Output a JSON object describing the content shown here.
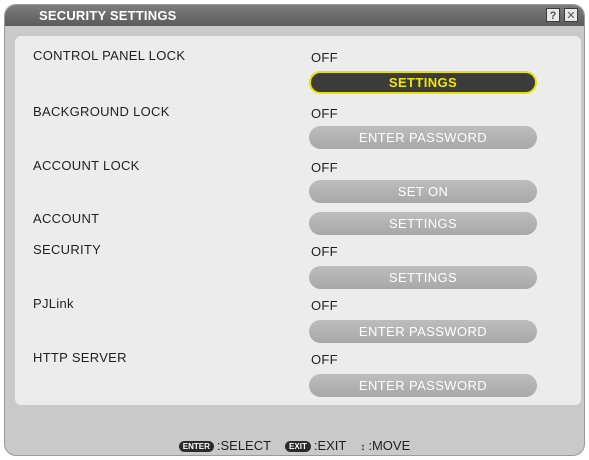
{
  "window": {
    "title": "SECURITY SETTINGS",
    "help_icon": "?",
    "close_icon": "✕"
  },
  "rows": {
    "control_panel_lock": {
      "label": "CONTROL PANEL LOCK",
      "value": "OFF",
      "button": "SETTINGS"
    },
    "background_lock": {
      "label": "BACKGROUND LOCK",
      "value": "OFF",
      "button": "ENTER PASSWORD"
    },
    "account_lock": {
      "label": "ACCOUNT LOCK",
      "value": "OFF",
      "button": "SET ON"
    },
    "account": {
      "label": "ACCOUNT",
      "button": "SETTINGS"
    },
    "security": {
      "label": "SECURITY",
      "value": "OFF",
      "button": "SETTINGS"
    },
    "pjlink": {
      "label": "PJLink",
      "value": "OFF",
      "button": "ENTER PASSWORD"
    },
    "http_server": {
      "label": "HTTP SERVER",
      "value": "OFF",
      "button": "ENTER PASSWORD"
    }
  },
  "footer": {
    "enter_key": "ENTER",
    "select_label": ":SELECT",
    "exit_key": "EXIT",
    "exit_label": ":EXIT",
    "move_glyph": "↕",
    "move_label": ":MOVE"
  },
  "colors": {
    "selected_border": "#e8e000",
    "selected_text": "#f0e800",
    "button_bg": "#b3b3b3"
  }
}
